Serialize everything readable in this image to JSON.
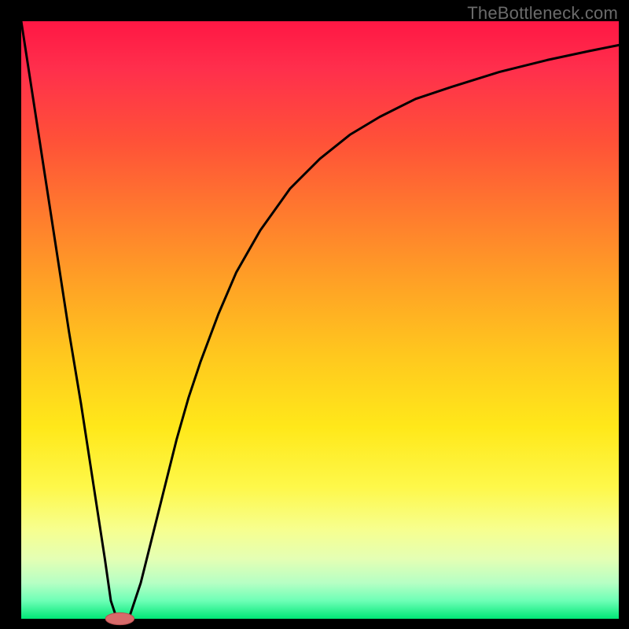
{
  "watermark": "TheBottleneck.com",
  "colors": {
    "frame": "#000000",
    "curve": "#000000",
    "marker_fill": "#d76a6a",
    "marker_stroke": "#b94f4f"
  },
  "chart_data": {
    "type": "line",
    "title": "",
    "xlabel": "",
    "ylabel": "",
    "xlim": [
      0,
      100
    ],
    "ylim": [
      0,
      100
    ],
    "grid": false,
    "legend": false,
    "series": [
      {
        "name": "bottleneck-curve",
        "x": [
          0,
          2,
          4,
          6,
          8,
          10,
          12,
          14,
          15,
          16,
          17,
          18,
          20,
          22,
          24,
          26,
          28,
          30,
          33,
          36,
          40,
          45,
          50,
          55,
          60,
          66,
          72,
          80,
          88,
          95,
          100
        ],
        "values": [
          100,
          87,
          74,
          61,
          48,
          36,
          23,
          10,
          3,
          0,
          0,
          0,
          6,
          14,
          22,
          30,
          37,
          43,
          51,
          58,
          65,
          72,
          77,
          81,
          84,
          87,
          89,
          91.5,
          93.5,
          95,
          96
        ]
      }
    ],
    "marker": {
      "name": "optimal-point",
      "x": 16.5,
      "y": 0,
      "rx_pct": 2.4,
      "ry_pct": 1.0
    },
    "gradient_stops": [
      {
        "offset": 0,
        "color": "#ff1744"
      },
      {
        "offset": 20,
        "color": "#ff5138"
      },
      {
        "offset": 44,
        "color": "#ffa225"
      },
      {
        "offset": 68,
        "color": "#ffe81a"
      },
      {
        "offset": 90,
        "color": "#e4ffb4"
      },
      {
        "offset": 100,
        "color": "#00e676"
      }
    ]
  }
}
